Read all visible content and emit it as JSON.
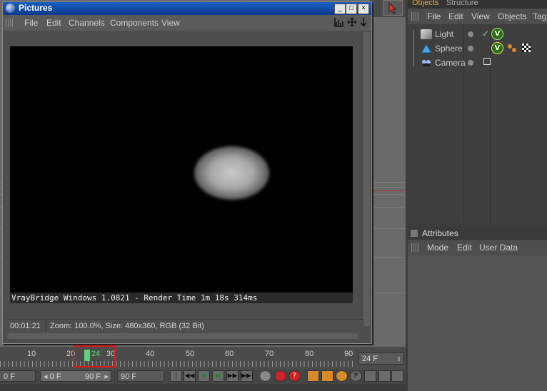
{
  "pictures_window": {
    "title": "Pictures",
    "controls": {
      "minimize": "_",
      "maximize": "□",
      "close": "×"
    },
    "menu": [
      "File",
      "Edit",
      "Channels",
      "Components",
      "View"
    ],
    "render_caption": "VrayBridge Windows 1.0821 - Render Time 1m 18s 314ms",
    "status_time": "00:01:21",
    "status_info": "Zoom: 100.0%, Size: 480x360, RGB (32 Bit)"
  },
  "objects_panel": {
    "tabs": [
      "Objects",
      "Structure"
    ],
    "menu": [
      "File",
      "Edit",
      "View",
      "Objects",
      "Tag"
    ],
    "items": [
      {
        "label": "Light",
        "icon": "light-icon"
      },
      {
        "label": "Sphere",
        "icon": "sphere-icon"
      },
      {
        "label": "Camera",
        "icon": "camera-icon"
      }
    ]
  },
  "attributes_panel": {
    "title": "Attributes",
    "menu": [
      "Mode",
      "Edit",
      "User Data"
    ]
  },
  "timeline": {
    "ticks": [
      "10",
      "20",
      "30",
      "40",
      "50",
      "60",
      "70",
      "80",
      "90"
    ],
    "current_frame": "24",
    "fps": "24 F"
  },
  "transport": {
    "start_field": "0 F",
    "start_left": "0 F",
    "end_in_slider": "90 F",
    "end_field": "90 F"
  },
  "colors": {
    "accent_green": "#5fd27a",
    "highlight_red": "#e01818",
    "title_blue": "#1a5fc0",
    "tab_active": "#e0a840"
  }
}
